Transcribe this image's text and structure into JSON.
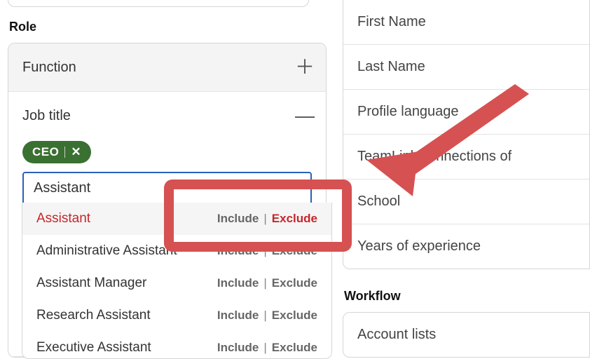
{
  "left": {
    "section_label": "Role",
    "function": {
      "label": "Function"
    },
    "job_title": {
      "label": "Job title",
      "chip": {
        "text": "CEO"
      },
      "search_value": "Assistant",
      "suggestions": [
        {
          "title": "Assistant",
          "highlight": true,
          "include": "Include",
          "exclude": "Exclude",
          "exclude_hl": true
        },
        {
          "title": "Administrative Assistant",
          "highlight": false,
          "include": "Include",
          "exclude": "Exclude",
          "exclude_hl": false
        },
        {
          "title": "Assistant Manager",
          "highlight": false,
          "include": "Include",
          "exclude": "Exclude",
          "exclude_hl": false
        },
        {
          "title": "Research Assistant",
          "highlight": false,
          "include": "Include",
          "exclude": "Exclude",
          "exclude_hl": false
        },
        {
          "title": "Executive Assistant",
          "highlight": false,
          "include": "Include",
          "exclude": "Exclude",
          "exclude_hl": false
        }
      ]
    }
  },
  "right": {
    "filters": [
      "First Name",
      "Last Name",
      "Profile language",
      "TeamLink connections of",
      "School",
      "Years of experience"
    ],
    "workflow_label": "Workflow",
    "workflow_items": [
      "Account lists"
    ]
  },
  "annotation": {
    "color": "#d65151"
  }
}
